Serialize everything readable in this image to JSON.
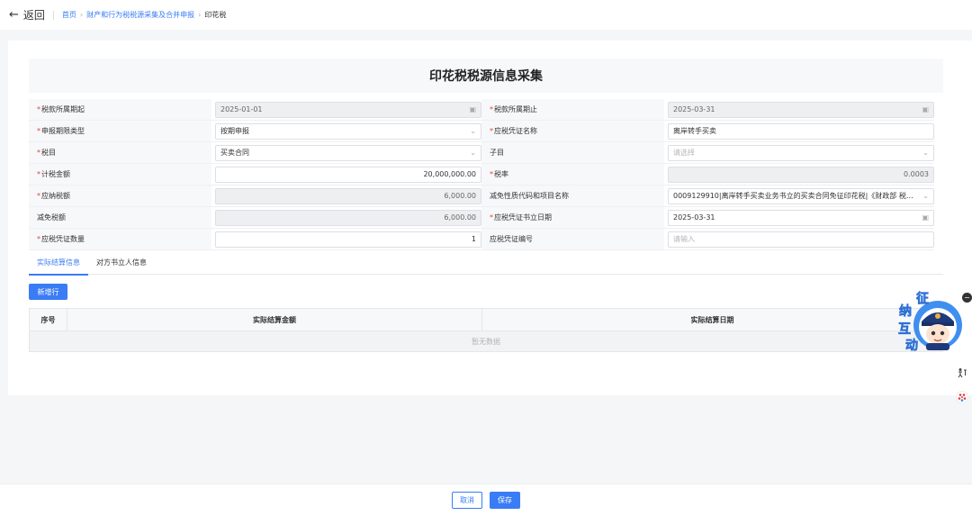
{
  "topbar": {
    "back_label": "返回",
    "breadcrumb": [
      "首页",
      "财产和行为税税源采集及合并申报",
      "印花税"
    ]
  },
  "form": {
    "title": "印花税税源信息采集",
    "rows": [
      {
        "left": {
          "label": "税款所属期起",
          "required": true,
          "value": "2025-01-01",
          "disabled": true,
          "icon": "calendar-icon"
        },
        "right": {
          "label": "税款所属期止",
          "required": true,
          "value": "2025-03-31",
          "disabled": true,
          "icon": "calendar-icon"
        }
      },
      {
        "left": {
          "label": "申报期限类型",
          "required": true,
          "value": "按期申报",
          "icon": "chevron-down-icon"
        },
        "right": {
          "label": "应税凭证名称",
          "required": true,
          "value": "离岸转手买卖"
        }
      },
      {
        "left": {
          "label": "税目",
          "required": true,
          "value": "买卖合同",
          "icon": "chevron-down-icon"
        },
        "right": {
          "label": "子目",
          "required": false,
          "placeholder": "请选择",
          "icon": "chevron-down-icon"
        }
      },
      {
        "left": {
          "label": "计税金额",
          "required": true,
          "value": "20,000,000.00",
          "align": "right"
        },
        "right": {
          "label": "税率",
          "required": true,
          "value": "0.0003",
          "disabled": true,
          "align": "right"
        }
      },
      {
        "left": {
          "label": "应纳税额",
          "required": true,
          "value": "6,000.00",
          "disabled": true,
          "align": "right"
        },
        "right": {
          "label": "减免性质代码和项目名称",
          "required": false,
          "value": "0009129910|离岸转手买卖业务书立的买卖合同免征印花税|《财政部 税务...",
          "icon": "chevron-down-icon"
        }
      },
      {
        "left": {
          "label": "减免税额",
          "required": false,
          "value": "6,000.00",
          "disabled": true,
          "align": "right"
        },
        "right": {
          "label": "应税凭证书立日期",
          "required": true,
          "value": "2025-03-31",
          "icon": "calendar-icon"
        }
      },
      {
        "left": {
          "label": "应税凭证数量",
          "required": true,
          "value": "1",
          "align": "right"
        },
        "right": {
          "label": "应税凭证编号",
          "required": false,
          "placeholder": "请输入"
        }
      }
    ]
  },
  "tabs": [
    "实际结算信息",
    "对方书立人信息"
  ],
  "active_tab": 0,
  "table": {
    "add_button": "新增行",
    "columns": [
      "序号",
      "实际结算金额",
      "实际结算日期"
    ],
    "empty_text": "暂无数据"
  },
  "footer": {
    "cancel": "取消",
    "save": "保存"
  },
  "mascot": {
    "chars": [
      "征",
      "纳",
      "互",
      "动"
    ]
  },
  "colors": {
    "primary": "#3a7cf6",
    "required": "#e8413b"
  }
}
